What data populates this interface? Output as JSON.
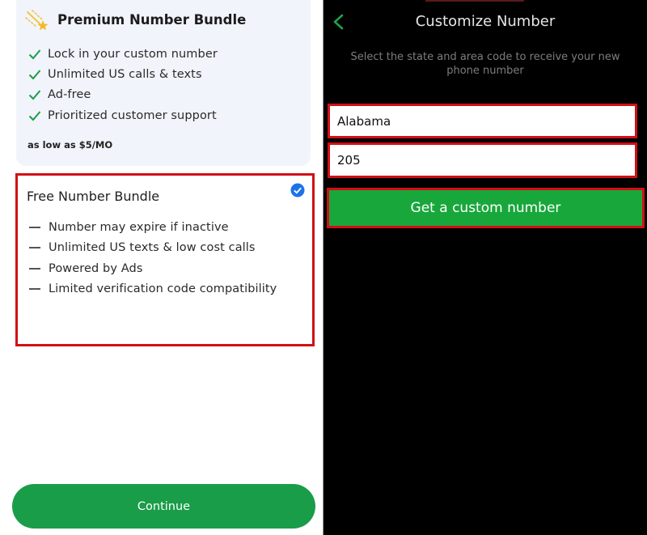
{
  "left": {
    "premium": {
      "title": "Premium Number Bundle",
      "icon": "shooting-star-icon",
      "features": [
        "Lock in your custom number",
        "Unlimited US calls & texts",
        "Ad-free",
        "Prioritized customer support"
      ],
      "price_note": "as low as $5/MO"
    },
    "free": {
      "title": "Free Number Bundle",
      "selected": true,
      "features": [
        "Number may expire if inactive",
        "Unlimited US texts & low cost calls",
        "Powered by Ads",
        "Limited verification code compatibility"
      ]
    },
    "continue_label": "Continue"
  },
  "right": {
    "title": "Customize Number",
    "subtitle": "Select the state and area code to receive your new phone number",
    "state_value": "Alabama",
    "area_code_value": "205",
    "button_label": "Get a custom number"
  },
  "colors": {
    "brand_green": "#1a9d48",
    "button_green": "#18a73b",
    "highlight_red": "#d10f16",
    "check_blue": "#1a73e8"
  }
}
